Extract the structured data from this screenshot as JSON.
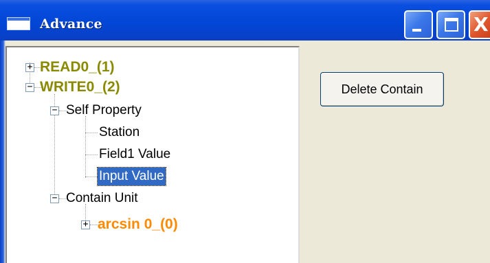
{
  "window": {
    "title": "Advance",
    "minimize_icon": "minimize-icon",
    "maximize_icon": "maximize-icon",
    "close_icon": "close-icon",
    "close_glyph": "X"
  },
  "tree": {
    "read_node": {
      "label": "READ0_(1)",
      "expander": "+"
    },
    "write_node": {
      "label": "WRITE0_(2)",
      "expander": "−"
    },
    "self_property": {
      "label": "Self Property",
      "expander": "−"
    },
    "station": {
      "label": "Station"
    },
    "field1_value": {
      "label": "Field1 Value"
    },
    "input_value": {
      "label": "Input Value",
      "selected": true
    },
    "contain_unit": {
      "label": "Contain Unit",
      "expander": "−"
    },
    "arcsin": {
      "label": "arcsin 0_(0)",
      "expander": "+"
    }
  },
  "actions": {
    "delete_contain": "Delete Contain"
  },
  "colors": {
    "titlebar": "#0246d6",
    "tree_olive": "#8a8a00",
    "tree_orange": "#ff8a00",
    "selection": "#316ac5",
    "dialog_bg": "#ece9d8"
  }
}
